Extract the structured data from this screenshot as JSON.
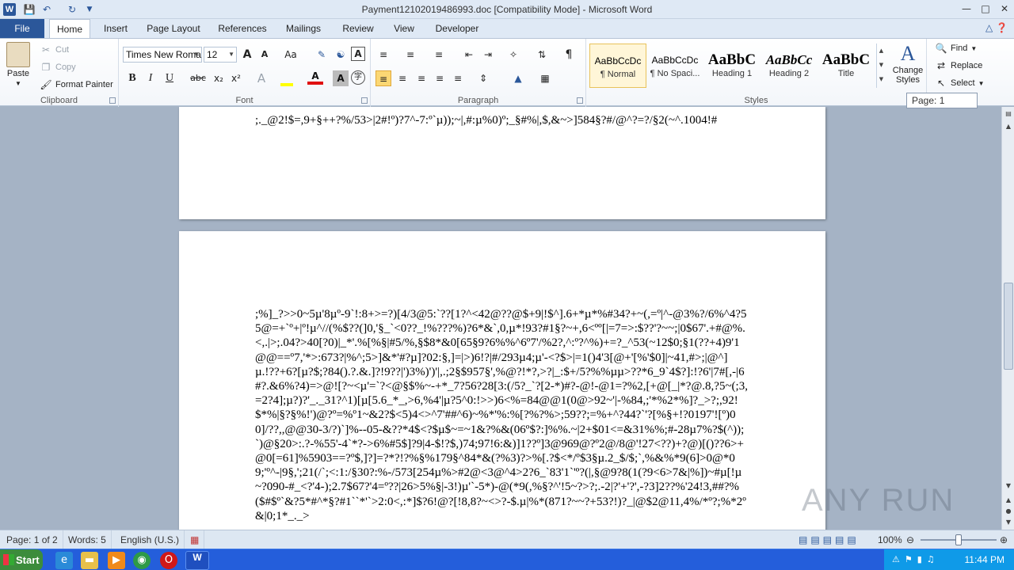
{
  "window": {
    "title": "Payment12102019486993.doc [Compatibility Mode]  -  Microsoft Word",
    "app_icon": "W"
  },
  "ribbon_tabs": [
    "File",
    "Home",
    "Insert",
    "Page Layout",
    "References",
    "Mailings",
    "Review",
    "View",
    "Developer"
  ],
  "active_tab": "Home",
  "clipboard": {
    "paste": "Paste",
    "cut": "Cut",
    "copy": "Copy",
    "format_painter": "Format Painter",
    "label": "Clipboard"
  },
  "font": {
    "name": "Times New Roma",
    "size": "12",
    "label": "Font",
    "bold": "B",
    "italic": "I",
    "underline": "U",
    "strike": "abc",
    "subscript": "x₂",
    "superscript": "x²",
    "grow": "A",
    "shrink": "A",
    "case": "Aa"
  },
  "paragraph": {
    "label": "Paragraph"
  },
  "styles": {
    "label": "Styles",
    "items": [
      {
        "preview": "AaBbCcDc",
        "name": "¶ Normal"
      },
      {
        "preview": "AaBbCcDc",
        "name": "¶ No Spaci..."
      },
      {
        "preview": "AaBbC",
        "name": "Heading 1"
      },
      {
        "preview": "AaBbCc",
        "name": "Heading 2"
      },
      {
        "preview": "AaBbC",
        "name": "Title"
      }
    ],
    "change_styles": "Change Styles"
  },
  "editing": {
    "label": "Editing",
    "find": "Find",
    "replace": "Replace",
    "select": "Select"
  },
  "page_tip": "Page: 1",
  "document": {
    "page1_text": ";._@2!$=,9+§++?%/53>|2#!º)?7^-7:º`µ));~|,#:µ%0)º;_§#%|,$,&~>]584§?#/@^?=?/§2(~^.1004!#",
    "page2_text": ";%]_?>>0~5µ'8µº-9`!:8+>=?)[4/3@5:`??[1?^<42@??@$+9|!$^].6+*µ*%#34?+~(,=º|^-@3%?/6%^4?55@=+`º+|º!µ^//(%$??(]0,'§_`<0??_!%???%)?6*&`,0,µ*!93?#1§?~+,6<ºº[|=7=>:$??'?~~;|0$67'.+#@%.<,.|>;.04?>40[?0)|_*'.%[%§|#5/%,§$8*&0[65§9?6%%^6º7'/%2?,^:º?^%)+=?_^53(~12$0;§1(??+4)9'1@@==º7,'*>:673?|%^;5>]&*'#?µ]?02:§,]=|>)6!?|#/293µ4;µ'-<?$>|=1()4'3[@+'[%'$0]|~41,#>;|@^]µ.!??+6?[µ?$;?84().?.&.]?!9??|')3%)')'|,.;2§$957§',%@?!*?,>?|_:$+/5?%%µµ>??*6_9`4$?]:!?6'|7#[,-|6#?.&6%?4)=>@![?~<µ'=`?<@§$%~-+*_7?56?28[3:(/5?_`?[2-*)#?-@!-@1=?%2,[+@[_|*?@.8,?5~(;3,=2?4];µ?)?'_._31?^1)[µ[5.6_*_,>6,%4'|µ?5^0:!>>)6<%=84@@1(0@>92~'|-%84,;'*%2*%]?_>?;,92!$*%|§?§%!')@?º=%º1~&2?$<5)4<>^7'##^6)~%*'%:%[?%?%>;59??;=%+^?44?`'?[%§+!?0197'![º)00]/??,,@@30-3/?)`]%--05-&??*4$<?$µ$~=~1&?%&(06º$?:]%%.~|2+$01<=&31%%;#-28µ7%?$(^));`)@§20>:.?-%55'-4`*?->6%#5$]?9|4-$!?$,)74;97!6:&)]1??º]3@969@?º2@/8@'!27<??)+?@)[()??6>+@0[=61]%5903==?º$,]?]=?*?!?%§%179§^84*&(?%3)?>%[.?$<*/º$3§µ.2_$/$;`,%&%*9(6]>0@*09;'º^-|9§,';21(/`;<:1:/§30?:%-/573[254µ%>#2@<3@^4>2?6_`83'1`'º?(|,§@9?8(1(?9<6>7&|%])~#µ[!µ~?090-#_<?'4-);2.7$67?'4=º??|26>5%§|-3!)µ'`-5*)-@(*9(,%§?^'!5~?>?;.-2|?'+'?',-?3]2??%'24!3,##?%($#$º`&?5*#^*§?#1``*'`>2:0<,:*]$?6!@?[!8,8?~<>?-$.µ|%*(871?~~?+53?!)?_|@$2@11,4%/*º?;%*2º&|0;1*_._>"
  },
  "statusbar": {
    "page": "Page: 1 of 2",
    "words": "Words: 5",
    "language": "English (U.S.)",
    "zoom": "100%"
  },
  "taskbar": {
    "start": "Start",
    "clock": "11:44 PM",
    "word_task": "W"
  },
  "watermark": "ANY RUN"
}
